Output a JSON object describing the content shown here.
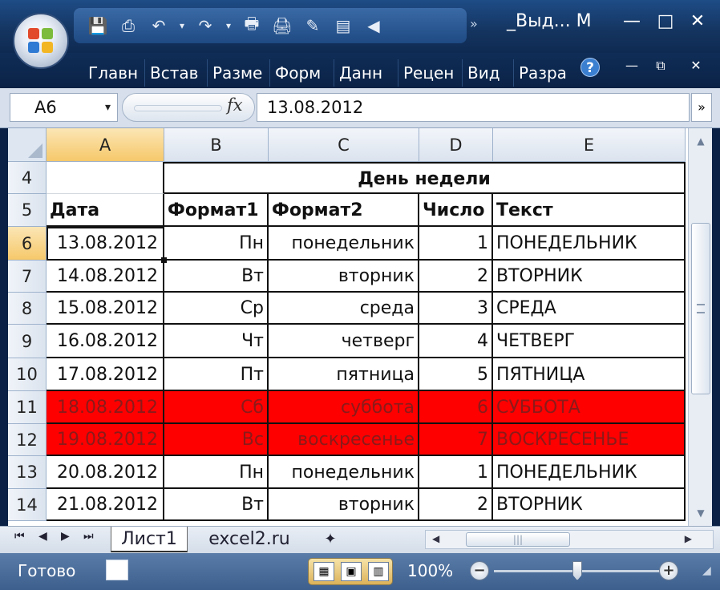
{
  "window": {
    "title": "_Выд... M",
    "minimize": "—",
    "restore": "□",
    "close": "✕",
    "ribbon_minimize": "—",
    "ribbon_restore": "⧉",
    "ribbon_close": "✕"
  },
  "quick_access": {
    "icons": [
      "save-icon",
      "print-preview-icon",
      "undo-icon",
      "undo-dropdown-icon",
      "redo-icon",
      "redo-dropdown-icon",
      "printer-icon",
      "print-icon",
      "paint-icon",
      "chart-icon",
      "back-icon",
      "more-icon"
    ],
    "more": "»"
  },
  "ribbon": {
    "tabs": [
      "Главн",
      "Встав",
      "Разме",
      "Форм",
      "Данн",
      "Рецен",
      "Вид",
      "Разра"
    ],
    "help": "?"
  },
  "formula_bar": {
    "name_box": "A6",
    "name_box_arrow": "▾",
    "fx": "fx",
    "formula": "13.08.2012",
    "expand": "»"
  },
  "sheet": {
    "columns": [
      "A",
      "B",
      "C",
      "D",
      "E"
    ],
    "selected_column": "A",
    "selected_row": "6",
    "rows": [
      {
        "num": "4",
        "cells": [
          "",
          "День недели",
          "",
          "",
          ""
        ]
      },
      {
        "num": "5",
        "cells": [
          "Дата",
          "Формат1",
          "Формат2",
          "Число",
          "Текст"
        ]
      },
      {
        "num": "6",
        "cells": [
          "13.08.2012",
          "Пн",
          "понедельник",
          "1",
          "ПОНЕДЕЛЬНИК"
        ]
      },
      {
        "num": "7",
        "cells": [
          "14.08.2012",
          "Вт",
          "вторник",
          "2",
          "ВТОРНИК"
        ]
      },
      {
        "num": "8",
        "cells": [
          "15.08.2012",
          "Ср",
          "среда",
          "3",
          "СРЕДА"
        ]
      },
      {
        "num": "9",
        "cells": [
          "16.08.2012",
          "Чт",
          "четверг",
          "4",
          "ЧЕТВЕРГ"
        ]
      },
      {
        "num": "10",
        "cells": [
          "17.08.2012",
          "Пт",
          "пятница",
          "5",
          "ПЯТНИЦА"
        ]
      },
      {
        "num": "11",
        "cells": [
          "18.08.2012",
          "Сб",
          "суббота",
          "6",
          "СУББОТА"
        ],
        "highlight": "#ff0000"
      },
      {
        "num": "12",
        "cells": [
          "19.08.2012",
          "Вс",
          "воскресенье",
          "7",
          "ВОСКРЕСЕНЬЕ"
        ],
        "highlight": "#ff0000"
      },
      {
        "num": "13",
        "cells": [
          "20.08.2012",
          "Пн",
          "понедельник",
          "1",
          "ПОНЕДЕЛЬНИК"
        ]
      },
      {
        "num": "14",
        "cells": [
          "21.08.2012",
          "Вт",
          "вторник",
          "2",
          "ВТОРНИК"
        ]
      }
    ]
  },
  "sheet_tabs": {
    "nav": [
      "⏮",
      "◀",
      "▶",
      "⏭"
    ],
    "tabs": [
      "Лист1",
      "excel2.ru"
    ],
    "active": "Лист1",
    "insert_icon": "insert-sheet-icon"
  },
  "status_bar": {
    "status": "Готово",
    "zoom": "100%",
    "zoom_minus": "−",
    "zoom_plus": "+",
    "zoom_level": 0.5
  }
}
